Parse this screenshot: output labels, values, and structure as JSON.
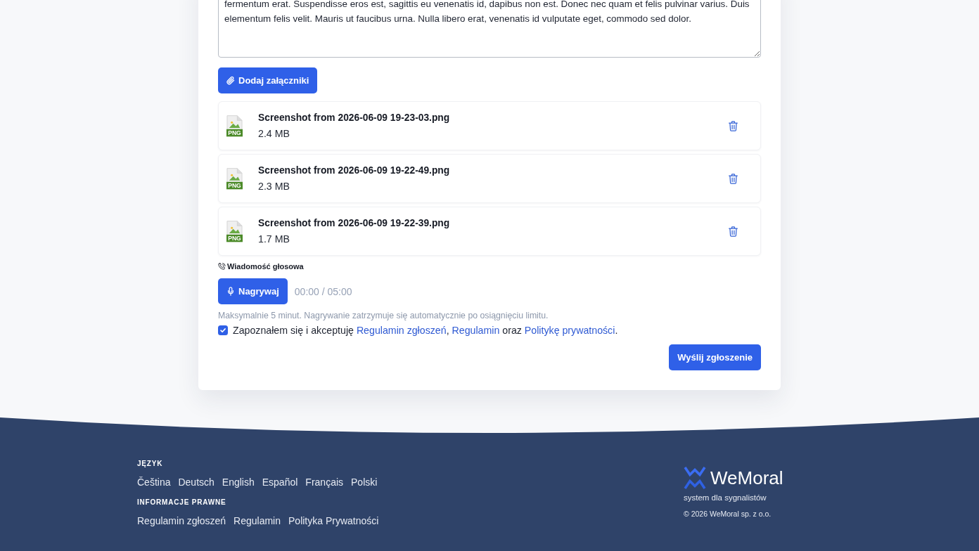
{
  "message": {
    "value": "fermentum erat. Suspendisse eros est, sagittis eu venenatis id, dapibus non est. Donec nec quam et felis pulvinar varius. Duis elementum felis velit. Mauris ut faucibus urna. Nulla libero erat, venenatis id vulputate eget, commodo sed dolor."
  },
  "attach_button": {
    "label": "Dodaj załączniki"
  },
  "attachments": [
    {
      "name": "Screenshot from 2026-06-09 19-23-03.png",
      "size": "2.4 MB",
      "type_label": "PNG"
    },
    {
      "name": "Screenshot from 2026-06-09 19-22-49.png",
      "size": "2.3 MB",
      "type_label": "PNG"
    },
    {
      "name": "Screenshot from 2026-06-09 19-22-39.png",
      "size": "1.7 MB",
      "type_label": "PNG"
    }
  ],
  "voice_message": {
    "label": "Wiadomość głosowa",
    "record_button": "Nagrywaj",
    "timer": "00:00 / 05:00",
    "hint": "Maksymalnie 5 minut. Nagrywanie zatrzymuje się automatycznie po osiągnięciu limitu."
  },
  "consent": {
    "checked": true,
    "segments": [
      {
        "kind": "text",
        "text": "Zapoznałem się i akceptuję "
      },
      {
        "kind": "link",
        "text": "Regulamin zgłoszeń"
      },
      {
        "kind": "text",
        "text": ", "
      },
      {
        "kind": "link",
        "text": "Regulamin"
      },
      {
        "kind": "text",
        "text": " oraz "
      },
      {
        "kind": "link",
        "text": "Politykę prywatności"
      },
      {
        "kind": "text",
        "text": "."
      }
    ]
  },
  "submit_button": {
    "label": "Wyślij zgłoszenie"
  },
  "footer": {
    "language": {
      "heading": "JĘZYK",
      "links": [
        "Čeština",
        "Deutsch",
        "English",
        "Español",
        "Français",
        "Polski"
      ]
    },
    "legal": {
      "heading": "INFORMACJE PRAWNE",
      "links": [
        "Regulamin zgłoszeń",
        "Regulamin",
        "Polityka Prywatności"
      ]
    },
    "brand": {
      "name": "WeMoral",
      "tagline": "system dla sygnalistów",
      "copyright": "© 2026 WeMoral sp. z o.o."
    }
  }
}
